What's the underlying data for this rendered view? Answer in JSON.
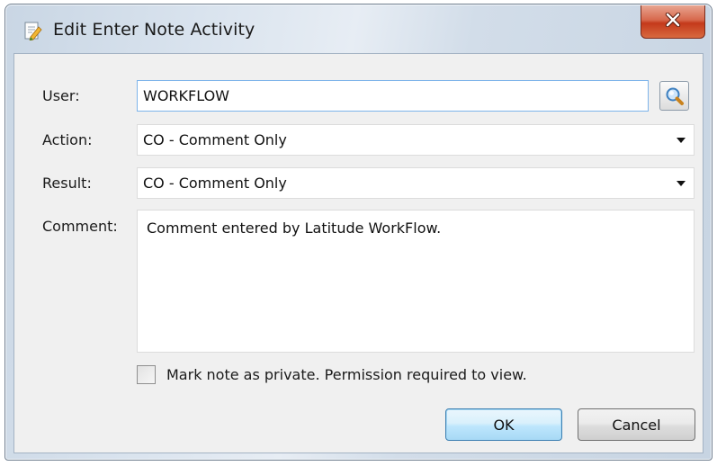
{
  "window": {
    "title": "Edit Enter Note Activity",
    "app_icon": "edit-note-icon",
    "close_icon": "close-icon"
  },
  "form": {
    "user_label": "User:",
    "user_value": "WORKFLOW",
    "lookup_icon": "search-icon",
    "action_label": "Action:",
    "action_value": "CO - Comment Only",
    "result_label": "Result:",
    "result_value": "CO - Comment Only",
    "comment_label": "Comment:",
    "comment_value": "Comment entered by Latitude WorkFlow.",
    "private_label": "Mark note as private.  Permission required to view.",
    "private_checked": false
  },
  "buttons": {
    "ok_label": "OK",
    "cancel_label": "Cancel"
  },
  "colors": {
    "close_button": "#c4391b",
    "default_button_border": "#3c7fb1",
    "focus_border": "#7eb4ea"
  }
}
